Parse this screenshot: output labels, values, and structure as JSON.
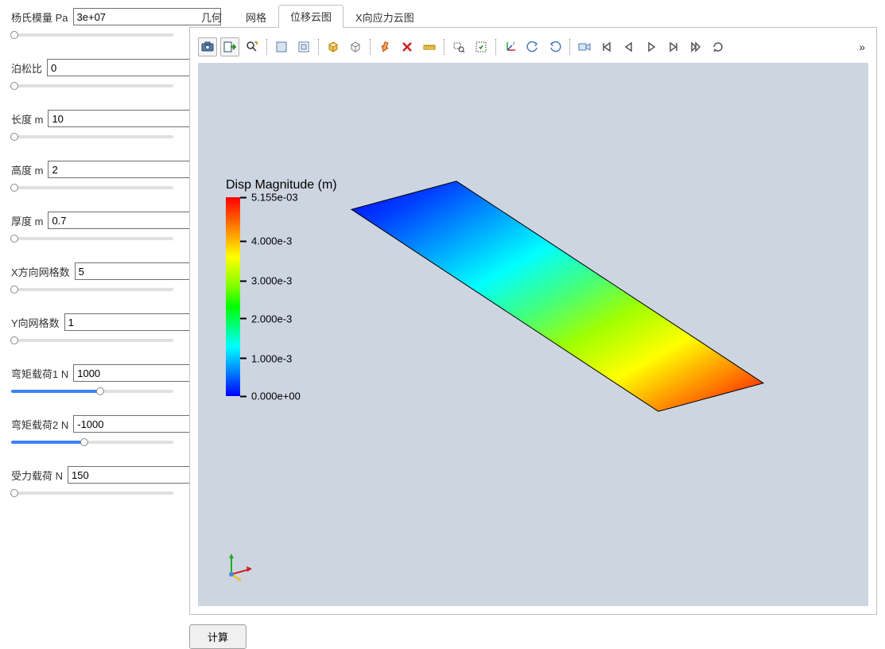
{
  "sidebar": {
    "params": [
      {
        "label": "杨氏模量 Pa",
        "value": "3e+07",
        "fill": 0
      },
      {
        "label": "泊松比",
        "value": "0",
        "fill": 0
      },
      {
        "label": "长度 m",
        "value": "10",
        "fill": 0
      },
      {
        "label": "高度 m",
        "value": "2",
        "fill": 0
      },
      {
        "label": "厚度 m",
        "value": "0.7",
        "fill": 0
      },
      {
        "label": "X方向网格数",
        "value": "5",
        "fill": 0
      },
      {
        "label": "Y向网格数",
        "value": "1",
        "fill": 0
      },
      {
        "label": "弯矩载荷1 N",
        "value": "1000",
        "fill": 55
      },
      {
        "label": "弯矩载荷2 N",
        "value": "-1000",
        "fill": 45
      },
      {
        "label": "受力载荷 N",
        "value": "150",
        "fill": 0
      }
    ]
  },
  "tabs": {
    "items": [
      {
        "label": "几何",
        "active": false
      },
      {
        "label": "网格",
        "active": false
      },
      {
        "label": "位移云图",
        "active": true
      },
      {
        "label": "X向应力云图",
        "active": false
      }
    ]
  },
  "toolbar": {
    "overflow": "»"
  },
  "viewer": {
    "legend_title": "Disp Magnitude (m)",
    "legend_ticks": [
      {
        "pos": 0,
        "label": "5.155e-03"
      },
      {
        "pos": 22,
        "label": "4.000e-3"
      },
      {
        "pos": 42,
        "label": "3.000e-3"
      },
      {
        "pos": 61,
        "label": "2.000e-3"
      },
      {
        "pos": 81,
        "label": "1.000e-3"
      },
      {
        "pos": 100,
        "label": "0.000e+00"
      }
    ]
  },
  "actions": {
    "calculate": "计算"
  },
  "chart_data": {
    "type": "contour",
    "title": "Disp Magnitude (m)",
    "quantity": "Displacement Magnitude",
    "unit": "m",
    "colormap": "rainbow",
    "range": {
      "min": 0.0,
      "max": 0.005155
    },
    "legend_ticks": [
      0.0,
      0.001,
      0.002,
      0.003,
      0.004,
      0.005155
    ],
    "geometry": "rectangular plate (isometric view)",
    "gradient_direction": "increases from blue (fixed end) to red (free end) along length"
  }
}
